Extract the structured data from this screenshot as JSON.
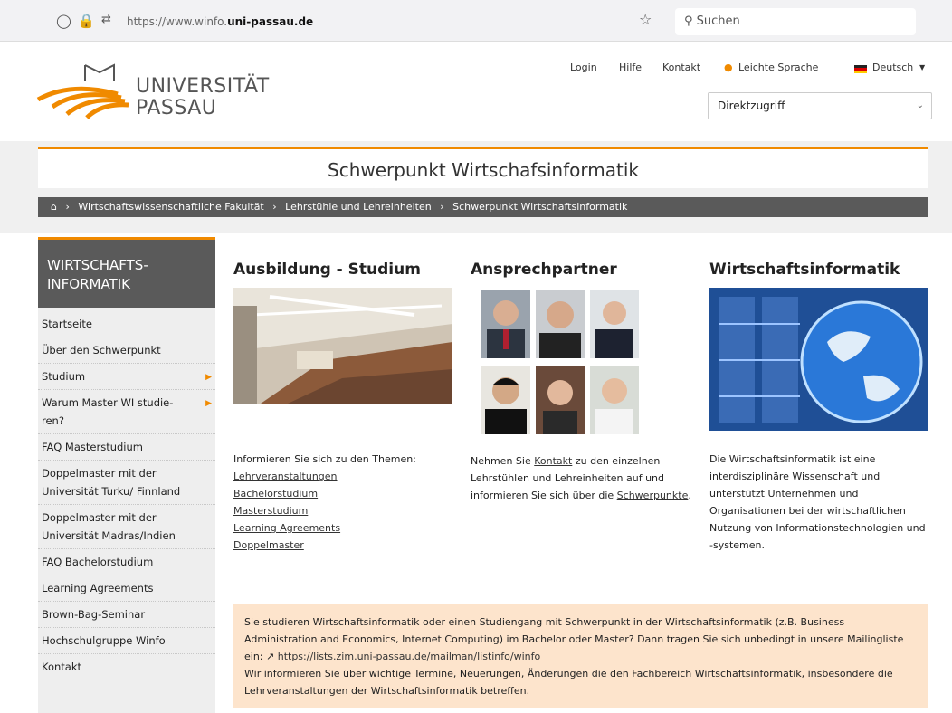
{
  "browser": {
    "url_prefix": "https://www.winfo.",
    "url_domain": "uni-passau.de",
    "search_placeholder": "Suchen"
  },
  "header": {
    "logo_line1": "UNIVERSITÄT",
    "logo_line2": "PASSAU",
    "nav": [
      "Login",
      "Hilfe",
      "Kontakt",
      "Leichte Sprache",
      "Deutsch"
    ],
    "direktzugriff": "Direktzugriff"
  },
  "page_title": "Schwerpunkt Wirtschafsinformatik",
  "breadcrumb": [
    "Wirtschaftswissenschaftliche Fakultät",
    "Lehrstühle und Lehreinheiten",
    "Schwerpunkt Wirtschaftsinformatik"
  ],
  "sidebar": {
    "title": "WIRTSCHAFTS-\nINFORMATIK",
    "items": [
      {
        "label": "Startseite"
      },
      {
        "label": "Über den Schwerpunkt"
      },
      {
        "label": "Studium"
      },
      {
        "label": "Warum Master WI studie-\nren?"
      },
      {
        "label": "FAQ Masterstudium"
      },
      {
        "label": "Doppelmaster mit der Universität Turku/ Finnland"
      },
      {
        "label": "Doppelmaster mit der Universität Madras/Indien"
      },
      {
        "label": "FAQ Bachelorstudium"
      },
      {
        "label": "Learning Agreements"
      },
      {
        "label": "Brown-Bag-Seminar"
      },
      {
        "label": "Hochschulgruppe Winfo"
      },
      {
        "label": "Kontakt"
      }
    ]
  },
  "col1": {
    "heading": "Ausbildung - Studium",
    "intro": "Informieren Sie sich zu den Themen:",
    "links": [
      "Lehrveranstaltungen",
      "Bachelorstudium ",
      "Masterstudium ",
      "Learning Agreements",
      "Doppelmaster"
    ]
  },
  "col2": {
    "heading": "Ansprechpartner",
    "text_a": "Nehmen Sie ",
    "link_a": "Kontakt",
    "text_b": " zu den einzelnen Lehrstühlen und Lehreinheiten auf und informieren Sie sich über die ",
    "link_b": "Schwerpunkte",
    "text_c": "."
  },
  "col3": {
    "heading": "Wirtschaftsinformatik",
    "text": "Die Wirtschaftsinformatik ist eine interdisziplinäre Wissenschaft und unterstützt Unternehmen und Organisationen bei der wirtschaftlichen Nutzung von Informationstechnologien und -systemen."
  },
  "notice": {
    "text_a": "Sie studieren Wirtschaftsinformatik oder einen Studiengang mit Schwerpunkt in der Wirtschaftsinformatik (z.B. Business Administration and Economics, Internet Computing) im Bachelor oder Master? Dann tragen Sie sich unbedingt in unsere Mailingliste ein: ",
    "link": "https://lists.zim.uni-passau.de/mailman/listinfo/winfo",
    "text_b": "Wir informieren Sie über wichtige Termine, Neuerungen, Änderungen die den Fachbereich Wirtschaftsinformatik, insbesondere die Lehrveranstaltungen der Wirtschaftsinformatik betreffen."
  },
  "colors": {
    "accent": "#f08a00",
    "dark": "#5a5a5a",
    "notice_bg": "#fde4cc"
  }
}
